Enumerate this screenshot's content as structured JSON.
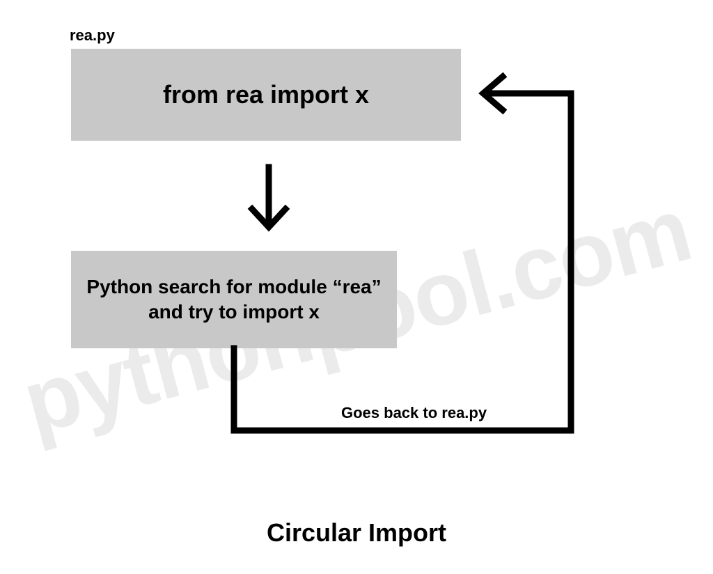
{
  "watermark": "pythonpool.com",
  "file_label": "rea.py",
  "box1_text": "from rea import x",
  "box2_text": "Python search for module “rea” and try to import x",
  "edge_label": "Goes back to rea.py",
  "title": "Circular Import"
}
